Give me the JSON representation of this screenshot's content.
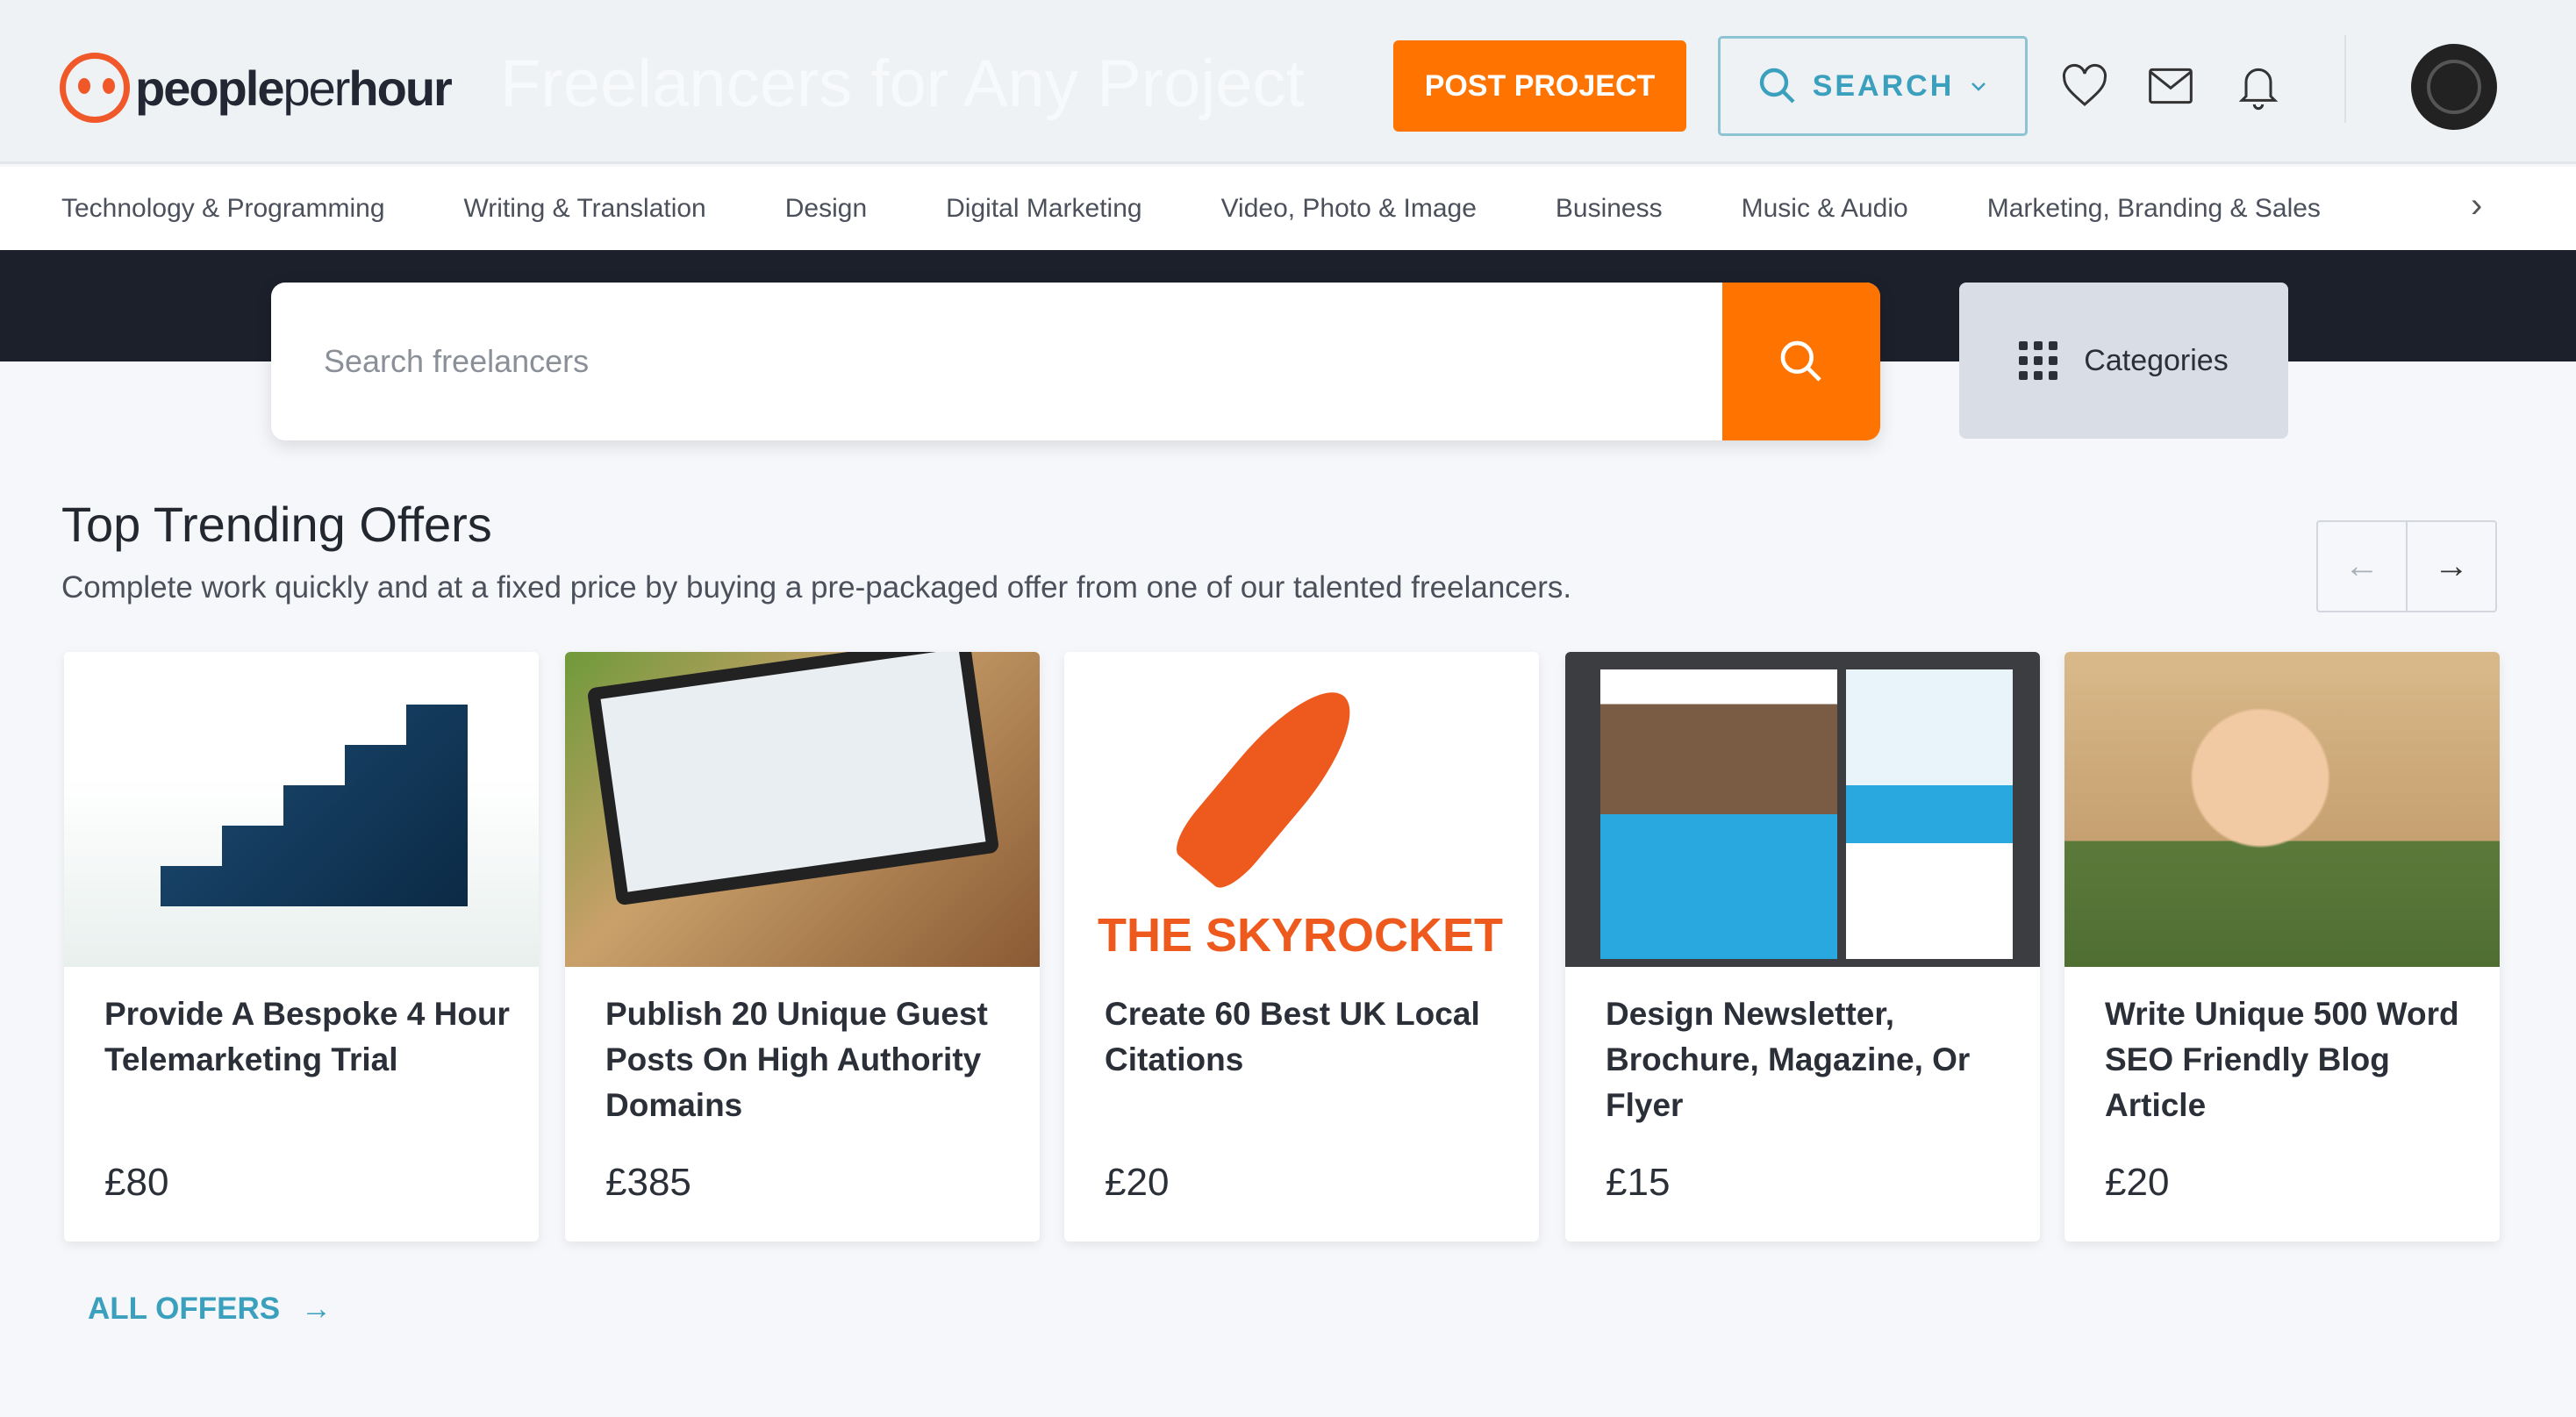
{
  "header": {
    "logo_bold": "people",
    "logo_light": "per",
    "logo_bold2": "hour",
    "ghost_title": "Freelancers for Any Project",
    "post_project": "POST PROJECT",
    "search": "SEARCH",
    "icons": [
      "heart-icon",
      "mail-icon",
      "bell-icon",
      "avatar"
    ]
  },
  "nav": {
    "items": [
      "Technology & Programming",
      "Writing & Translation",
      "Design",
      "Digital Marketing",
      "Video, Photo & Image",
      "Business",
      "Music & Audio",
      "Marketing, Branding & Sales"
    ],
    "next": "›"
  },
  "search": {
    "placeholder": "Search freelancers",
    "categories": "Categories"
  },
  "section": {
    "title": "Top Trending Offers",
    "subtitle": "Complete work quickly and at a fixed price by buying a pre-packaged offer from one of our talented freelancers.",
    "prev": "←",
    "next": "→"
  },
  "offers": [
    {
      "title": "Provide A Bespoke 4 Hour Telemarketing Trial",
      "price": "£80"
    },
    {
      "title": "Publish 20 Unique Guest Posts On High Authority Domains",
      "price": "£385"
    },
    {
      "title": "Create 60 Best UK Local Citations",
      "price": "£20",
      "image_text": "THE SKYROCKET"
    },
    {
      "title": "Design Newsletter, Brochure, Magazine, Or Flyer",
      "price": "£15"
    },
    {
      "title": "Write Unique 500 Word SEO Friendly Blog Article",
      "price": "£20"
    }
  ],
  "all_offers": "ALL OFFERS",
  "colors": {
    "accent": "#ff7300",
    "link": "#3aa0bd",
    "dark_band": "#1b202b"
  }
}
